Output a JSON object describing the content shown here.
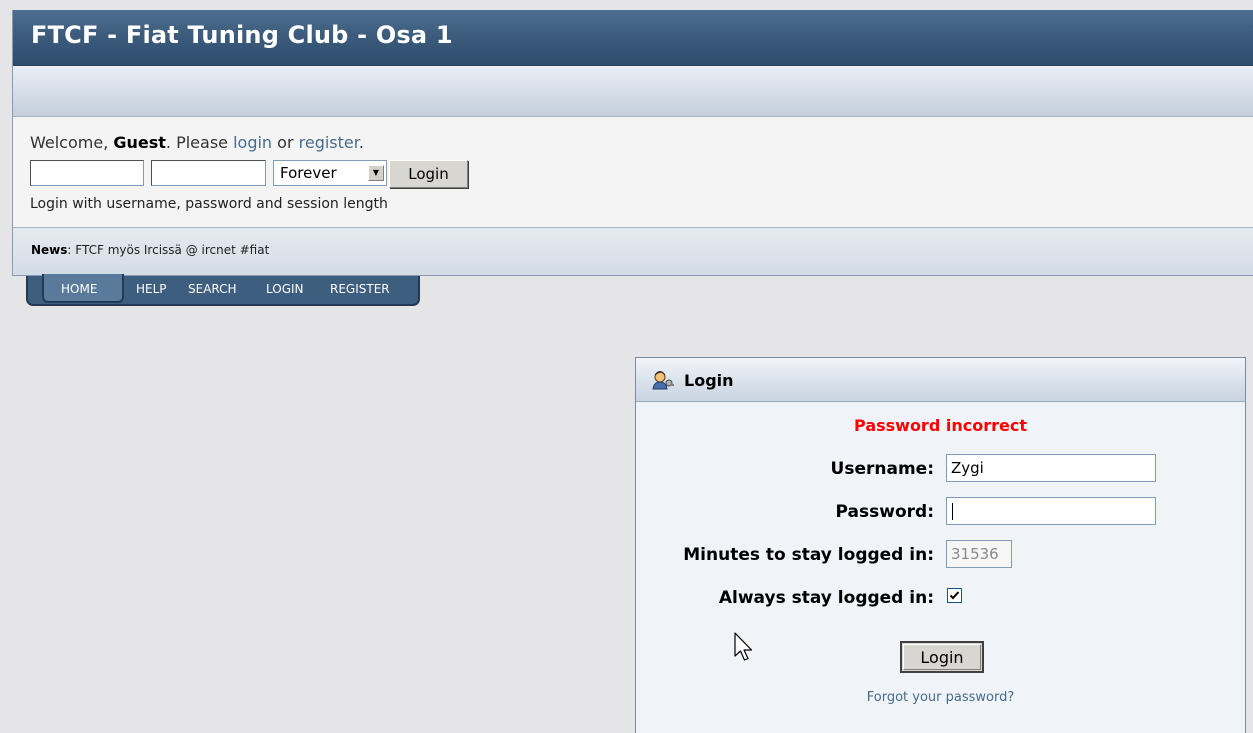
{
  "header": {
    "title": "FTCF - Fiat Tuning Club - Osa 1"
  },
  "welcome": {
    "prefix": "Welcome, ",
    "guest": "Guest",
    "middle": ". Please ",
    "login_link": "login",
    "or": " or ",
    "register_link": "register",
    "suffix": ".",
    "username_value": "",
    "password_value": "",
    "session_length": "Forever",
    "login_button": "Login",
    "hint": "Login with username, password and session length"
  },
  "news": {
    "label": "News",
    "text": ": FTCF myös Ircissä @ ircnet #fiat"
  },
  "tabs": {
    "home": "HOME",
    "help": "HELP",
    "search": "SEARCH",
    "login": "LOGIN",
    "register": "REGISTER"
  },
  "login_panel": {
    "title": "Login",
    "error": "Password incorrect",
    "username_label": "Username:",
    "username_value": "Zygi",
    "password_label": "Password:",
    "password_value": "",
    "minutes_label": "Minutes to stay logged in:",
    "minutes_value": "31536",
    "always_label": "Always stay logged in:",
    "always_checked": true,
    "login_button": "Login",
    "forgot_link": "Forgot your password?"
  }
}
